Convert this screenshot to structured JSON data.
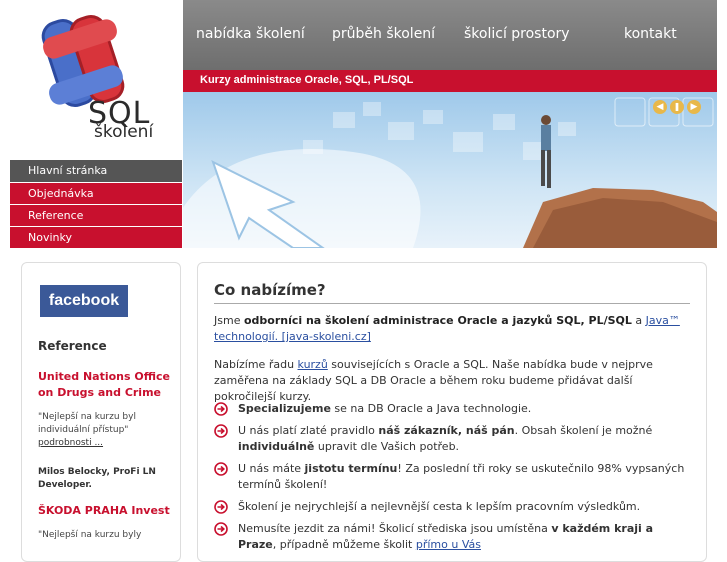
{
  "logo": {
    "wordmark": "SQL",
    "sub": "školení"
  },
  "topnav": {
    "items": [
      "nabídka školení",
      "průběh školení",
      "školicí prostory",
      "kontakt"
    ]
  },
  "redbar": {
    "text": "Kurzy administrace Oracle, SQL, PL/SQL"
  },
  "menu": {
    "items": [
      "Hlavní stránka",
      "Objednávka",
      "Reference",
      "Novinky"
    ]
  },
  "sidebar": {
    "facebook": "facebook",
    "heading": "Reference",
    "refs": [
      {
        "title": "United Nations Office on Drugs and Crime",
        "quote": "\"Nejlepší na kurzu byl individuální přístup\"",
        "more": "podrobnosti ...",
        "author": "Milos Belocky, ProFi LN Developer."
      },
      {
        "title": "ŠKODA PRAHA Invest",
        "quote": "\"Nejlepší na kurzu byly"
      }
    ]
  },
  "main": {
    "title": "Co nabízíme?",
    "p1": {
      "a": "Jsme ",
      "b": "odborníci na školení administrace Oracle a jazyků SQL, PL/SQL",
      "c": " a ",
      "link": "Java™ technologií. [java-skoleni.cz]"
    },
    "p2": {
      "a": "Nabízíme řadu ",
      "link": "kurzů",
      "b": " souvisejících s Oracle a SQL. Naše nabídka bude v nejprve zaměřena na základy SQL a DB Oracle a během roku budeme přidávat další pokročilejší kurzy."
    },
    "list": [
      {
        "b": "Specializujeme",
        "a": " se na DB Oracle a Java technologie."
      },
      {
        "a": "U nás platí zlaté pravidlo ",
        "b": "náš zákazník, náš pán",
        "c": ". Obsah školení je možné ",
        "d": "individuálně",
        "e": " upravit dle Vašich potřeb."
      },
      {
        "a": "U nás máte ",
        "b": "jistotu termínu",
        "c": "! Za poslední tři roky se uskutečnilo 98% vypsaných termínů školení!"
      },
      {
        "a": "Školení je nejrychlejší a nejlevnější cesta k lepším pracovním výsledkům."
      },
      {
        "a": "Nemusíte jezdit za námi! Školicí střediska jsou umístěna ",
        "b": "v každém kraji a Praze",
        "c": ", případně můžeme školit ",
        "link": "přímo u Vás"
      }
    ]
  },
  "colors": {
    "accent": "#c8102e",
    "nav": "#777777",
    "link": "#2a4fa0"
  }
}
